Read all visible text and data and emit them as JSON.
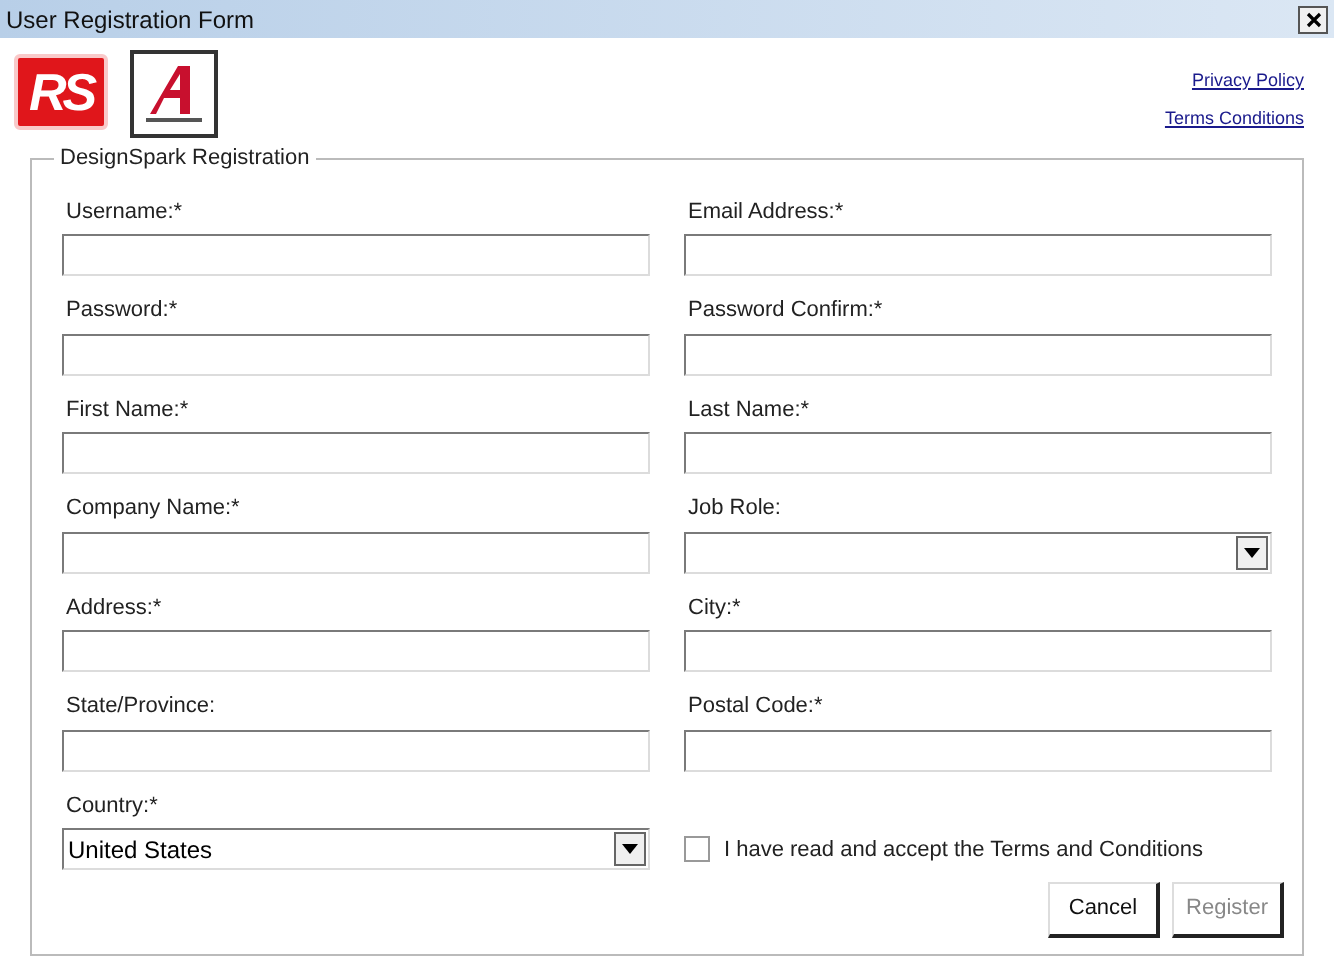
{
  "window": {
    "title": "User Registration Form"
  },
  "logo": {
    "text": "RS"
  },
  "links": [
    {
      "label": "Privacy Policy"
    },
    {
      "label": "Terms  Conditions"
    }
  ],
  "form": {
    "legend": "DesignSpark Registration",
    "fields": [
      {
        "label": "Username:*",
        "kind": "text"
      },
      {
        "label": "Email Address:*",
        "kind": "text"
      },
      {
        "label": "Password:*",
        "kind": "text"
      },
      {
        "label": "Password Confirm:*",
        "kind": "text"
      },
      {
        "label": "First Name:*",
        "kind": "text"
      },
      {
        "label": "Last Name:*",
        "kind": "text"
      },
      {
        "label": "Company Name:*",
        "kind": "text"
      },
      {
        "label": "Job Role:",
        "kind": "select"
      },
      {
        "label": "Address:*",
        "kind": "text"
      },
      {
        "label": "City:*",
        "kind": "text"
      },
      {
        "label": "State/Province:",
        "kind": "text"
      },
      {
        "label": "Postal Code:*",
        "kind": "text"
      },
      {
        "label": "Country:*",
        "kind": "select",
        "value": "United States"
      }
    ],
    "agree": {
      "label": "I have read and accept the Terms and Conditions",
      "checked": false
    }
  },
  "buttons": [
    {
      "label": "Cancel",
      "disabled": false
    },
    {
      "label": "Register",
      "disabled": true
    }
  ]
}
